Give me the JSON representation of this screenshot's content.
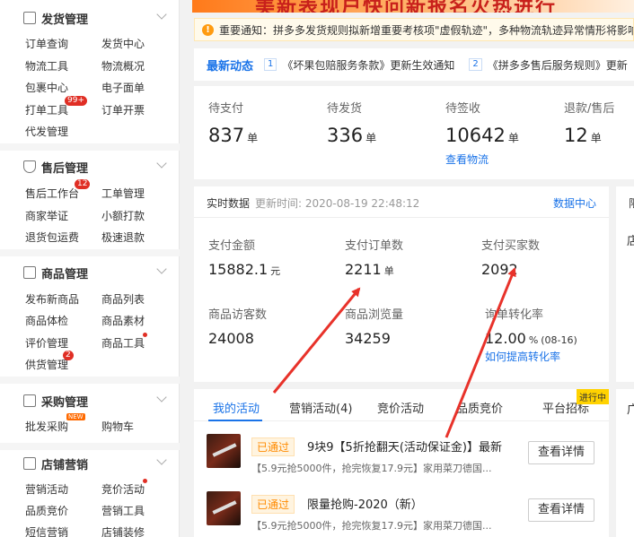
{
  "sidebar": {
    "groups": [
      {
        "title": "发货管理",
        "icon": "document-icon",
        "items": [
          "订单查询",
          "发货中心",
          "物流工具",
          "物流概况",
          "包裹中心",
          "电子面单",
          "打单工具",
          "订单开票",
          "代发管理"
        ],
        "badges": {
          "打单工具": "99+"
        }
      },
      {
        "title": "售后管理",
        "icon": "shield-icon",
        "items": [
          "售后工作台",
          "工单管理",
          "商家举证",
          "小额打款",
          "退货包运费",
          "极速退款"
        ],
        "badges": {
          "售后工作台": "12"
        }
      },
      {
        "title": "商品管理",
        "icon": "box-icon",
        "items": [
          "发布新商品",
          "商品列表",
          "商品体检",
          "商品素材",
          "评价管理",
          "商品工具",
          "供货管理"
        ],
        "badges": {
          "供货管理": "2"
        }
      },
      {
        "title": "采购管理",
        "icon": "cart-icon",
        "items": [
          "批发采购",
          "购物车"
        ],
        "badges": {
          "批发采购": "NEW"
        }
      },
      {
        "title": "店铺营销",
        "icon": "store-icon",
        "items": [
          "营销活动",
          "竞价活动",
          "品质竞价",
          "营销工具",
          "短信营销",
          "店铺装修"
        ]
      }
    ]
  },
  "banner": {
    "text": "美新表现户快问新报名火热进行"
  },
  "notice": {
    "label": "重要通知：",
    "text": "拼多多发货规则拟新增重要考核项\"虚假轨迹\"，多种物流轨迹异常情形将影响"
  },
  "news": {
    "title": "最新动态",
    "items": [
      {
        "num": "1",
        "text": "《坏果包赔服务条款》更新生效通知"
      },
      {
        "num": "2",
        "text": "《拼多多售后服务规则》更新"
      }
    ]
  },
  "stats": [
    {
      "label": "待支付",
      "value": "837",
      "unit": "单"
    },
    {
      "label": "待发货",
      "value": "336",
      "unit": "单"
    },
    {
      "label": "待签收",
      "value": "10642",
      "unit": "单",
      "link": "查看物流"
    },
    {
      "label": "退款/售后",
      "value": "12",
      "unit": "单"
    }
  ],
  "realtime": {
    "title": "实时数据",
    "updated": "更新时间: 2020-08-19 22:48:12",
    "data_center": "数据中心",
    "metrics": [
      {
        "label": "支付金额",
        "value": "15882.1",
        "unit": "元"
      },
      {
        "label": "支付订单数",
        "value": "2211",
        "unit": "单"
      },
      {
        "label": "支付买家数",
        "value": "2092",
        "unit": ""
      },
      {
        "label": "商品访客数",
        "value": "24008",
        "unit": ""
      },
      {
        "label": "商品浏览量",
        "value": "34259",
        "unit": ""
      },
      {
        "label": "询单转化率",
        "value": "12.00",
        "unit": "%",
        "extra": "(08-16)",
        "link": "如何提高转化率"
      }
    ]
  },
  "side_cards": {
    "c1a": "限",
    "c1b": "店",
    "c2": "广"
  },
  "activities": {
    "tabs": [
      "我的活动",
      "营销活动(4)",
      "竞价活动",
      "品质竞价",
      "平台招标"
    ],
    "hot_tag": "进行中",
    "rows": [
      {
        "status": "已通过",
        "name": "9块9【5折抢翻天(活动保证金)】最新",
        "desc": "【5.9元抢5000件，抢完恢复17.9元】家用菜刀德国...",
        "button": "查看详情"
      },
      {
        "status": "已通过",
        "name": "限量抢购-2020（新）",
        "desc": "【5.9元抢5000件，抢完恢复17.9元】家用菜刀德国...",
        "button": "查看详情"
      }
    ]
  },
  "colors": {
    "accent": "#1a73e8",
    "badge": "#e02e24",
    "arrow": "#e8322a",
    "status": "#ff8a00"
  }
}
